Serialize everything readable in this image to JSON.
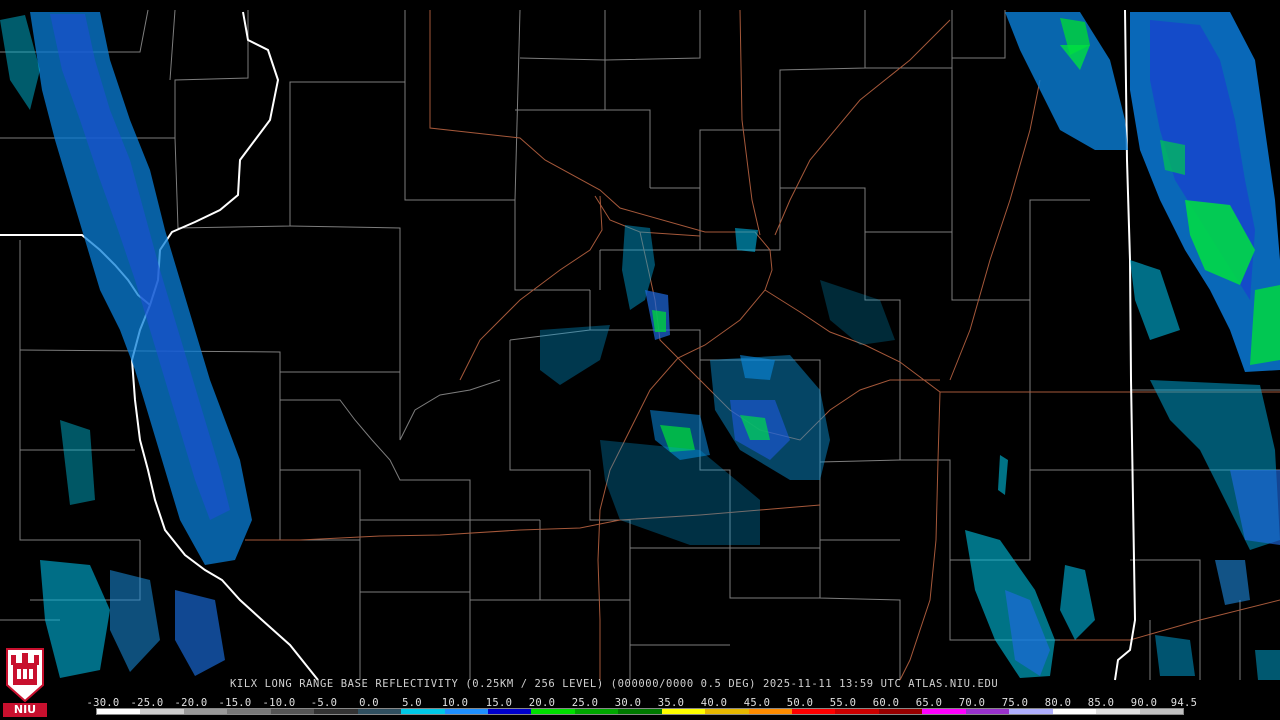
{
  "map": {
    "product_caption": "KILX LONG RANGE BASE REFLECTIVITY (0.25KM / 256 LEVEL) (000000/0000 0.5 DEG) 2025-11-11 13:59 UTC  ATLAS.NIU.EDU",
    "background_color": "#000000",
    "county_line_color": "#8a8a8a",
    "state_line_color": "#ffffff",
    "highway_color": "#b0623a"
  },
  "logo": {
    "text": "NIU",
    "color": "#c8102e"
  },
  "scale": {
    "labels": [
      "-30.0",
      "-25.0",
      "-20.0",
      "-15.0",
      "-10.0",
      "-5.0",
      "0.0",
      "5.0",
      "10.0",
      "15.0",
      "20.0",
      "25.0",
      "30.0",
      "35.0",
      "40.0",
      "45.0",
      "50.0",
      "55.0",
      "60.0",
      "65.0",
      "70.0",
      "75.0",
      "80.0",
      "85.0",
      "90.0",
      "94.5"
    ],
    "colors": [
      "#ffffff",
      "#cccccc",
      "#999999",
      "#777777",
      "#555555",
      "#333333",
      "#2f4f5f",
      "#00c8e6",
      "#1e90ff",
      "#0000cd",
      "#00e000",
      "#00a800",
      "#007a00",
      "#ffff00",
      "#e6b800",
      "#ff8c00",
      "#ff0000",
      "#cc0000",
      "#990000",
      "#ff00ff",
      "#9932cc",
      "#b0b0ff",
      "#ffffff",
      "#e0e0e0",
      "#c0c0c0"
    ]
  }
}
